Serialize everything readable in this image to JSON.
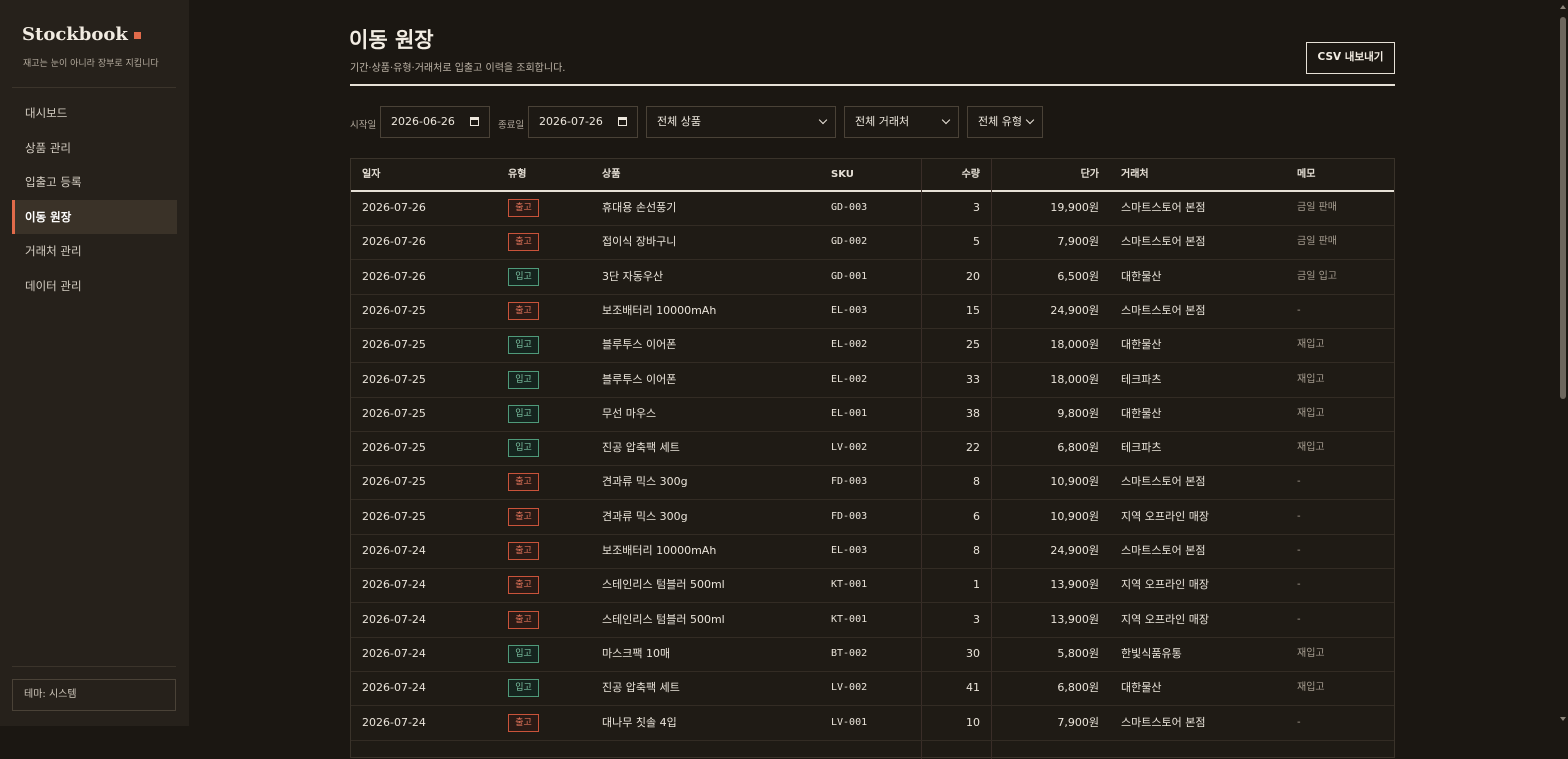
{
  "sidebar": {
    "brand": "Stockbook",
    "tagline": "재고는 눈이 아니라 장부로 지킵니다",
    "items": [
      {
        "label": "대시보드",
        "active": false
      },
      {
        "label": "상품 관리",
        "active": false
      },
      {
        "label": "입출고 등록",
        "active": false
      },
      {
        "label": "이동 원장",
        "active": true
      },
      {
        "label": "거래처 관리",
        "active": false
      },
      {
        "label": "데이터 관리",
        "active": false
      }
    ],
    "theme_label": "테마: 시스템"
  },
  "header": {
    "title": "이동 원장",
    "subtitle": "기간·상품·유형·거래처로 입출고 이력을 조회합니다.",
    "export_label": "CSV 내보내기"
  },
  "filters": {
    "start_label": "시작일",
    "start_value": "2026-06-26",
    "end_label": "종료일",
    "end_value": "2026-07-26",
    "product_value": "전체 상품",
    "partner_value": "전체 거래처",
    "type_value": "전체 유형"
  },
  "table": {
    "headers": [
      "일자",
      "유형",
      "상품",
      "SKU",
      "수량",
      "단가",
      "거래처",
      "메모"
    ],
    "rows": [
      {
        "date": "2026-07-26",
        "type": "출고",
        "kind": "out",
        "product": "휴대용 손선풍기",
        "sku": "GD-003",
        "qty": "3",
        "price": "19,900원",
        "partner": "스마트스토어 본점",
        "memo": "금일 판매"
      },
      {
        "date": "2026-07-26",
        "type": "출고",
        "kind": "out",
        "product": "접이식 장바구니",
        "sku": "GD-002",
        "qty": "5",
        "price": "7,900원",
        "partner": "스마트스토어 본점",
        "memo": "금일 판매"
      },
      {
        "date": "2026-07-26",
        "type": "입고",
        "kind": "in",
        "product": "3단 자동우산",
        "sku": "GD-001",
        "qty": "20",
        "price": "6,500원",
        "partner": "대한물산",
        "memo": "금일 입고"
      },
      {
        "date": "2026-07-25",
        "type": "출고",
        "kind": "out",
        "product": "보조배터리 10000mAh",
        "sku": "EL-003",
        "qty": "15",
        "price": "24,900원",
        "partner": "스마트스토어 본점",
        "memo": "-"
      },
      {
        "date": "2026-07-25",
        "type": "입고",
        "kind": "in",
        "product": "블루투스 이어폰",
        "sku": "EL-002",
        "qty": "25",
        "price": "18,000원",
        "partner": "대한물산",
        "memo": "재입고"
      },
      {
        "date": "2026-07-25",
        "type": "입고",
        "kind": "in",
        "product": "블루투스 이어폰",
        "sku": "EL-002",
        "qty": "33",
        "price": "18,000원",
        "partner": "테크파츠",
        "memo": "재입고"
      },
      {
        "date": "2026-07-25",
        "type": "입고",
        "kind": "in",
        "product": "무선 마우스",
        "sku": "EL-001",
        "qty": "38",
        "price": "9,800원",
        "partner": "대한물산",
        "memo": "재입고"
      },
      {
        "date": "2026-07-25",
        "type": "입고",
        "kind": "in",
        "product": "진공 압축팩 세트",
        "sku": "LV-002",
        "qty": "22",
        "price": "6,800원",
        "partner": "테크파츠",
        "memo": "재입고"
      },
      {
        "date": "2026-07-25",
        "type": "출고",
        "kind": "out",
        "product": "견과류 믹스 300g",
        "sku": "FD-003",
        "qty": "8",
        "price": "10,900원",
        "partner": "스마트스토어 본점",
        "memo": "-"
      },
      {
        "date": "2026-07-25",
        "type": "출고",
        "kind": "out",
        "product": "견과류 믹스 300g",
        "sku": "FD-003",
        "qty": "6",
        "price": "10,900원",
        "partner": "지역 오프라인 매장",
        "memo": "-"
      },
      {
        "date": "2026-07-24",
        "type": "출고",
        "kind": "out",
        "product": "보조배터리 10000mAh",
        "sku": "EL-003",
        "qty": "8",
        "price": "24,900원",
        "partner": "스마트스토어 본점",
        "memo": "-"
      },
      {
        "date": "2026-07-24",
        "type": "출고",
        "kind": "out",
        "product": "스테인리스 텀블러 500ml",
        "sku": "KT-001",
        "qty": "1",
        "price": "13,900원",
        "partner": "지역 오프라인 매장",
        "memo": "-"
      },
      {
        "date": "2026-07-24",
        "type": "출고",
        "kind": "out",
        "product": "스테인리스 텀블러 500ml",
        "sku": "KT-001",
        "qty": "3",
        "price": "13,900원",
        "partner": "지역 오프라인 매장",
        "memo": "-"
      },
      {
        "date": "2026-07-24",
        "type": "입고",
        "kind": "in",
        "product": "마스크팩 10매",
        "sku": "BT-002",
        "qty": "30",
        "price": "5,800원",
        "partner": "한빛식품유통",
        "memo": "재입고"
      },
      {
        "date": "2026-07-24",
        "type": "입고",
        "kind": "in",
        "product": "진공 압축팩 세트",
        "sku": "LV-002",
        "qty": "41",
        "price": "6,800원",
        "partner": "대한물산",
        "memo": "재입고"
      },
      {
        "date": "2026-07-24",
        "type": "출고",
        "kind": "out",
        "product": "대나무 칫솔 4입",
        "sku": "LV-001",
        "qty": "10",
        "price": "7,900원",
        "partner": "스마트스토어 본점",
        "memo": "-"
      }
    ]
  }
}
